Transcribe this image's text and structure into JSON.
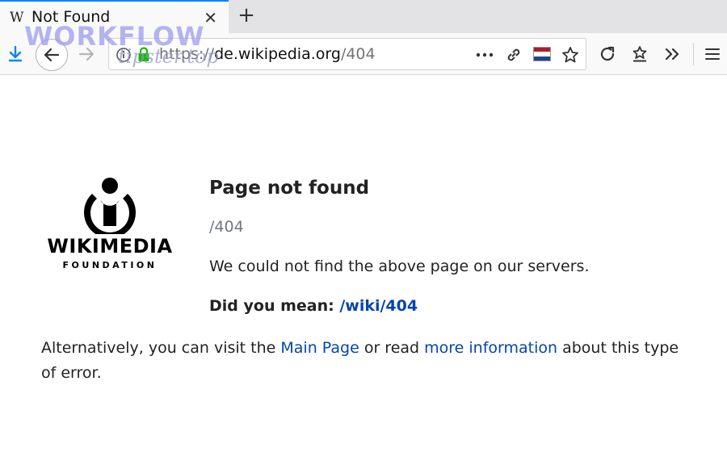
{
  "tab": {
    "title": "Not Found",
    "favicon": "wikipedia-w-icon"
  },
  "navbar": {
    "url_scheme": "https://",
    "url_host": "de.wikipedia.org",
    "url_path": "/404"
  },
  "watermark": {
    "line1": "WORKFLOW",
    "line2": "tipster.top"
  },
  "logo": {
    "word": "WIKIMEDIA",
    "sub": "FOUNDATION"
  },
  "page": {
    "heading": "Page not found",
    "path": "/404",
    "message": "We could not find the above page on our servers.",
    "did_you_mean_label": "Did you mean: ",
    "did_you_mean_link": "/wiki/404",
    "alt_prefix": "Alternatively, you can visit the ",
    "alt_link1": "Main Page",
    "alt_mid": " or read ",
    "alt_link2": "more information",
    "alt_suffix": " about this type of error."
  },
  "colors": {
    "link": "#0645ad",
    "accent": "#0a84ff",
    "lock": "#12bc00"
  }
}
